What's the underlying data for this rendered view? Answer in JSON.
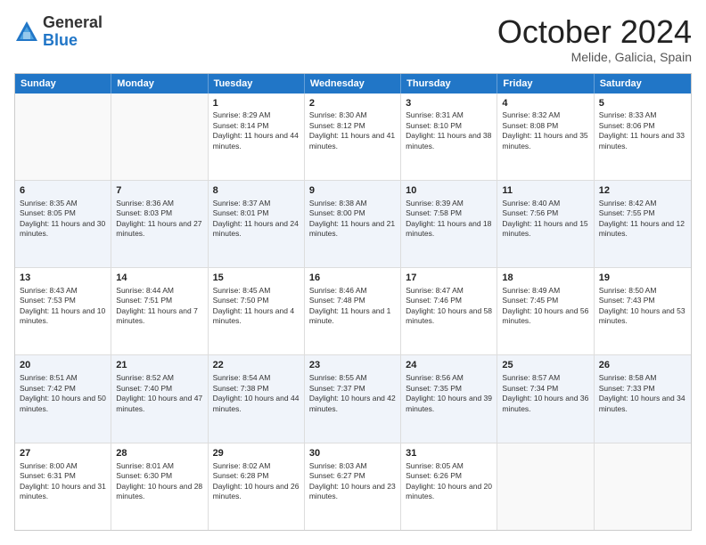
{
  "logo": {
    "general": "General",
    "blue": "Blue"
  },
  "header": {
    "month": "October 2024",
    "location": "Melide, Galicia, Spain"
  },
  "days": [
    "Sunday",
    "Monday",
    "Tuesday",
    "Wednesday",
    "Thursday",
    "Friday",
    "Saturday"
  ],
  "weeks": [
    [
      {
        "day": "",
        "sunrise": "",
        "sunset": "",
        "daylight": ""
      },
      {
        "day": "",
        "sunrise": "",
        "sunset": "",
        "daylight": ""
      },
      {
        "day": "1",
        "sunrise": "Sunrise: 8:29 AM",
        "sunset": "Sunset: 8:14 PM",
        "daylight": "Daylight: 11 hours and 44 minutes."
      },
      {
        "day": "2",
        "sunrise": "Sunrise: 8:30 AM",
        "sunset": "Sunset: 8:12 PM",
        "daylight": "Daylight: 11 hours and 41 minutes."
      },
      {
        "day": "3",
        "sunrise": "Sunrise: 8:31 AM",
        "sunset": "Sunset: 8:10 PM",
        "daylight": "Daylight: 11 hours and 38 minutes."
      },
      {
        "day": "4",
        "sunrise": "Sunrise: 8:32 AM",
        "sunset": "Sunset: 8:08 PM",
        "daylight": "Daylight: 11 hours and 35 minutes."
      },
      {
        "day": "5",
        "sunrise": "Sunrise: 8:33 AM",
        "sunset": "Sunset: 8:06 PM",
        "daylight": "Daylight: 11 hours and 33 minutes."
      }
    ],
    [
      {
        "day": "6",
        "sunrise": "Sunrise: 8:35 AM",
        "sunset": "Sunset: 8:05 PM",
        "daylight": "Daylight: 11 hours and 30 minutes."
      },
      {
        "day": "7",
        "sunrise": "Sunrise: 8:36 AM",
        "sunset": "Sunset: 8:03 PM",
        "daylight": "Daylight: 11 hours and 27 minutes."
      },
      {
        "day": "8",
        "sunrise": "Sunrise: 8:37 AM",
        "sunset": "Sunset: 8:01 PM",
        "daylight": "Daylight: 11 hours and 24 minutes."
      },
      {
        "day": "9",
        "sunrise": "Sunrise: 8:38 AM",
        "sunset": "Sunset: 8:00 PM",
        "daylight": "Daylight: 11 hours and 21 minutes."
      },
      {
        "day": "10",
        "sunrise": "Sunrise: 8:39 AM",
        "sunset": "Sunset: 7:58 PM",
        "daylight": "Daylight: 11 hours and 18 minutes."
      },
      {
        "day": "11",
        "sunrise": "Sunrise: 8:40 AM",
        "sunset": "Sunset: 7:56 PM",
        "daylight": "Daylight: 11 hours and 15 minutes."
      },
      {
        "day": "12",
        "sunrise": "Sunrise: 8:42 AM",
        "sunset": "Sunset: 7:55 PM",
        "daylight": "Daylight: 11 hours and 12 minutes."
      }
    ],
    [
      {
        "day": "13",
        "sunrise": "Sunrise: 8:43 AM",
        "sunset": "Sunset: 7:53 PM",
        "daylight": "Daylight: 11 hours and 10 minutes."
      },
      {
        "day": "14",
        "sunrise": "Sunrise: 8:44 AM",
        "sunset": "Sunset: 7:51 PM",
        "daylight": "Daylight: 11 hours and 7 minutes."
      },
      {
        "day": "15",
        "sunrise": "Sunrise: 8:45 AM",
        "sunset": "Sunset: 7:50 PM",
        "daylight": "Daylight: 11 hours and 4 minutes."
      },
      {
        "day": "16",
        "sunrise": "Sunrise: 8:46 AM",
        "sunset": "Sunset: 7:48 PM",
        "daylight": "Daylight: 11 hours and 1 minute."
      },
      {
        "day": "17",
        "sunrise": "Sunrise: 8:47 AM",
        "sunset": "Sunset: 7:46 PM",
        "daylight": "Daylight: 10 hours and 58 minutes."
      },
      {
        "day": "18",
        "sunrise": "Sunrise: 8:49 AM",
        "sunset": "Sunset: 7:45 PM",
        "daylight": "Daylight: 10 hours and 56 minutes."
      },
      {
        "day": "19",
        "sunrise": "Sunrise: 8:50 AM",
        "sunset": "Sunset: 7:43 PM",
        "daylight": "Daylight: 10 hours and 53 minutes."
      }
    ],
    [
      {
        "day": "20",
        "sunrise": "Sunrise: 8:51 AM",
        "sunset": "Sunset: 7:42 PM",
        "daylight": "Daylight: 10 hours and 50 minutes."
      },
      {
        "day": "21",
        "sunrise": "Sunrise: 8:52 AM",
        "sunset": "Sunset: 7:40 PM",
        "daylight": "Daylight: 10 hours and 47 minutes."
      },
      {
        "day": "22",
        "sunrise": "Sunrise: 8:54 AM",
        "sunset": "Sunset: 7:38 PM",
        "daylight": "Daylight: 10 hours and 44 minutes."
      },
      {
        "day": "23",
        "sunrise": "Sunrise: 8:55 AM",
        "sunset": "Sunset: 7:37 PM",
        "daylight": "Daylight: 10 hours and 42 minutes."
      },
      {
        "day": "24",
        "sunrise": "Sunrise: 8:56 AM",
        "sunset": "Sunset: 7:35 PM",
        "daylight": "Daylight: 10 hours and 39 minutes."
      },
      {
        "day": "25",
        "sunrise": "Sunrise: 8:57 AM",
        "sunset": "Sunset: 7:34 PM",
        "daylight": "Daylight: 10 hours and 36 minutes."
      },
      {
        "day": "26",
        "sunrise": "Sunrise: 8:58 AM",
        "sunset": "Sunset: 7:33 PM",
        "daylight": "Daylight: 10 hours and 34 minutes."
      }
    ],
    [
      {
        "day": "27",
        "sunrise": "Sunrise: 8:00 AM",
        "sunset": "Sunset: 6:31 PM",
        "daylight": "Daylight: 10 hours and 31 minutes."
      },
      {
        "day": "28",
        "sunrise": "Sunrise: 8:01 AM",
        "sunset": "Sunset: 6:30 PM",
        "daylight": "Daylight: 10 hours and 28 minutes."
      },
      {
        "day": "29",
        "sunrise": "Sunrise: 8:02 AM",
        "sunset": "Sunset: 6:28 PM",
        "daylight": "Daylight: 10 hours and 26 minutes."
      },
      {
        "day": "30",
        "sunrise": "Sunrise: 8:03 AM",
        "sunset": "Sunset: 6:27 PM",
        "daylight": "Daylight: 10 hours and 23 minutes."
      },
      {
        "day": "31",
        "sunrise": "Sunrise: 8:05 AM",
        "sunset": "Sunset: 6:26 PM",
        "daylight": "Daylight: 10 hours and 20 minutes."
      },
      {
        "day": "",
        "sunrise": "",
        "sunset": "",
        "daylight": ""
      },
      {
        "day": "",
        "sunrise": "",
        "sunset": "",
        "daylight": ""
      }
    ]
  ]
}
